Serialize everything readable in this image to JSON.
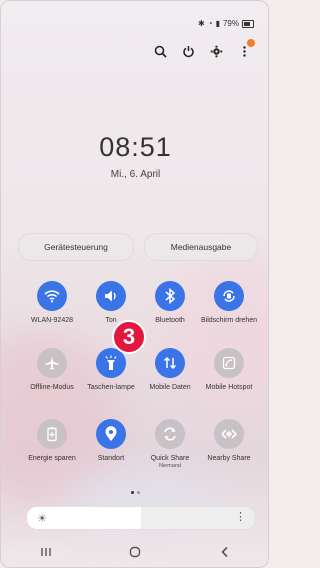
{
  "status": {
    "text": "79%",
    "battery_icon": "battery-icon"
  },
  "topbar": {
    "icons": [
      "search-icon",
      "power-icon",
      "gear-icon",
      "more-vert-icon"
    ]
  },
  "clock": {
    "time": "08:51",
    "date": "Mi., 6. April"
  },
  "pills": {
    "left": "Gerätesteuerung",
    "right": "Medienausgabe"
  },
  "tiles": [
    {
      "label": "WLAN-92428",
      "sub": "",
      "icon": "wifi-icon",
      "on": true
    },
    {
      "label": "Ton",
      "sub": "",
      "icon": "sound-icon",
      "on": true
    },
    {
      "label": "Bluetooth",
      "sub": "",
      "icon": "bluetooth-icon",
      "on": true
    },
    {
      "label": "Bildschirm drehen",
      "sub": "",
      "icon": "rotate-icon",
      "on": true
    },
    {
      "label": "Offline-Modus",
      "sub": "",
      "icon": "airplane-icon",
      "on": false
    },
    {
      "label": "Taschen-lampe",
      "sub": "",
      "icon": "flashlight-icon",
      "on": true
    },
    {
      "label": "Mobile Daten",
      "sub": "",
      "icon": "data-icon",
      "on": true
    },
    {
      "label": "Mobile Hotspot",
      "sub": "",
      "icon": "hotspot-icon",
      "on": false
    },
    {
      "label": "Energie sparen",
      "sub": "",
      "icon": "battery-save-icon",
      "on": false
    },
    {
      "label": "Standort",
      "sub": "",
      "icon": "location-icon",
      "on": true
    },
    {
      "label": "Quick Share",
      "sub": "Niemand",
      "icon": "quickshare-icon",
      "on": false
    },
    {
      "label": "Nearby Share",
      "sub": "",
      "icon": "nearby-share-icon",
      "on": false
    }
  ],
  "callout": {
    "number": "3"
  },
  "brightness": {
    "level": 0.5
  },
  "navbar": {
    "icons": [
      "recent-apps-icon",
      "home-icon",
      "back-icon"
    ]
  },
  "colors": {
    "accent": "#3a74e7",
    "badge": "#e2173f"
  }
}
